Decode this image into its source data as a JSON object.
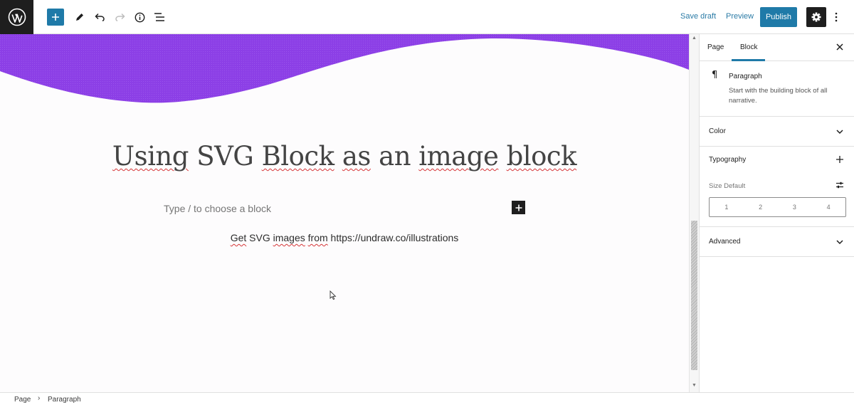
{
  "toolbar": {
    "add_label": "+",
    "save_draft": "Save draft",
    "preview": "Preview",
    "publish": "Publish",
    "icons": [
      "wordpress-logo-icon",
      "plus-icon",
      "pencil-icon",
      "undo-icon",
      "redo-icon",
      "info-icon",
      "list-view-icon",
      "gear-icon",
      "more-vertical-icon"
    ]
  },
  "editor": {
    "title_words": [
      "Using",
      "SVG",
      "Block",
      "as",
      "an",
      "image",
      "block"
    ],
    "placeholder": "Type / to choose a block",
    "paragraph_prefix_words": [
      "Get",
      "SVG",
      "images",
      "from"
    ],
    "paragraph_link": "https://undraw.co/illustrations",
    "wave_color": "#8c3fe6"
  },
  "sidebar": {
    "tabs": {
      "page": "Page",
      "block": "Block"
    },
    "block_card": {
      "name": "Paragraph",
      "description": "Start with the building block of all narrative."
    },
    "panels": {
      "color": "Color",
      "typography": "Typography",
      "size_label": "Size",
      "size_value": "Default",
      "size_options": [
        "1",
        "2",
        "3",
        "4"
      ],
      "advanced": "Advanced"
    }
  },
  "footer": {
    "crumbs": [
      "Page",
      "Paragraph"
    ]
  },
  "colors": {
    "accent": "#1f7aa8",
    "dark": "#1e1e1e",
    "wave": "#8c3fe6"
  }
}
